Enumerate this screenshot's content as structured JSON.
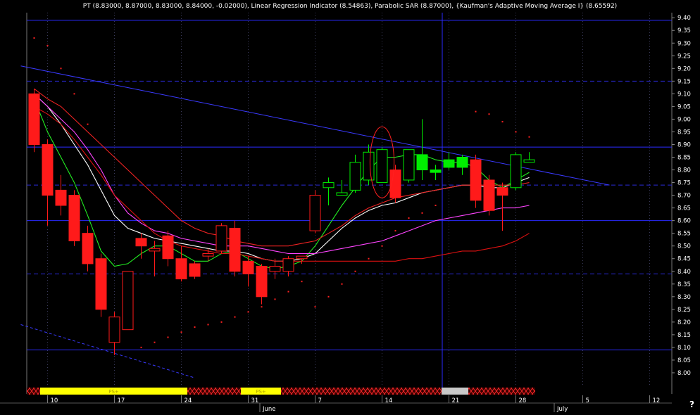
{
  "chart_data": {
    "type": "candlestick",
    "title": "PT (8.83000, 8.87000, 8.83000, 8.84000, -0.02000), Linear Regression Indicator (8.54863), Parabolic SAR (8.87000), {Kaufman's Adaptive Moving Average I} (8.65592)",
    "ylim": [
      7.95,
      9.42
    ],
    "y_ticks": [
      "9.40",
      "9.35",
      "9.30",
      "9.25",
      "9.20",
      "9.15",
      "9.10",
      "9.05",
      "9.00",
      "8.95",
      "8.90",
      "8.85",
      "8.80",
      "8.75",
      "8.70",
      "8.65",
      "8.60",
      "8.55",
      "8.50",
      "8.45",
      "8.40",
      "8.35",
      "8.30",
      "8.25",
      "8.20",
      "8.15",
      "8.10",
      "8.05",
      "8.00"
    ],
    "x_day_labels": [
      {
        "label": "10",
        "i": 1
      },
      {
        "label": "17",
        "i": 6
      },
      {
        "label": "24",
        "i": 11
      },
      {
        "label": "31",
        "i": 16
      },
      {
        "label": "7",
        "i": 21
      },
      {
        "label": "14",
        "i": 26
      },
      {
        "label": "21",
        "i": 31
      },
      {
        "label": "28",
        "i": 36
      },
      {
        "label": "5",
        "i": 41
      },
      {
        "label": "12",
        "i": 46
      }
    ],
    "x_month_labels": [
      {
        "label": "June",
        "i": 17.5
      },
      {
        "label": "July",
        "i": 39.5
      }
    ],
    "candles": [
      {
        "o": 9.1,
        "h": 9.12,
        "l": 8.87,
        "c": 8.9,
        "color": "red"
      },
      {
        "o": 8.9,
        "h": 8.92,
        "l": 8.58,
        "c": 8.7,
        "color": "red"
      },
      {
        "o": 8.72,
        "h": 8.78,
        "l": 8.62,
        "c": 8.66,
        "color": "red"
      },
      {
        "o": 8.7,
        "h": 8.72,
        "l": 8.5,
        "c": 8.52,
        "color": "red"
      },
      {
        "o": 8.55,
        "h": 8.58,
        "l": 8.4,
        "c": 8.43,
        "color": "red"
      },
      {
        "o": 8.45,
        "h": 8.47,
        "l": 8.22,
        "c": 8.25,
        "color": "red"
      },
      {
        "o": 8.12,
        "h": 8.24,
        "l": 8.07,
        "c": 8.22,
        "color": "red"
      },
      {
        "o": 8.17,
        "h": 8.4,
        "l": 8.17,
        "c": 8.4,
        "color": "red"
      },
      {
        "o": 8.53,
        "h": 8.55,
        "l": 8.45,
        "c": 8.5,
        "color": "red"
      },
      {
        "o": 8.48,
        "h": 8.52,
        "l": 8.38,
        "c": 8.49,
        "color": "red"
      },
      {
        "o": 8.54,
        "h": 8.56,
        "l": 8.42,
        "c": 8.45,
        "color": "red"
      },
      {
        "o": 8.45,
        "h": 8.5,
        "l": 8.36,
        "c": 8.37,
        "color": "red"
      },
      {
        "o": 8.43,
        "h": 8.44,
        "l": 8.37,
        "c": 8.38,
        "color": "red"
      },
      {
        "o": 8.46,
        "h": 8.49,
        "l": 8.44,
        "c": 8.47,
        "color": "red"
      },
      {
        "o": 8.48,
        "h": 8.59,
        "l": 8.47,
        "c": 8.58,
        "color": "red"
      },
      {
        "o": 8.57,
        "h": 8.6,
        "l": 8.38,
        "c": 8.4,
        "color": "red"
      },
      {
        "o": 8.44,
        "h": 8.46,
        "l": 8.34,
        "c": 8.39,
        "color": "red"
      },
      {
        "o": 8.42,
        "h": 8.43,
        "l": 8.27,
        "c": 8.3,
        "color": "red"
      },
      {
        "o": 8.4,
        "h": 8.45,
        "l": 8.37,
        "c": 8.42,
        "color": "red"
      },
      {
        "o": 8.4,
        "h": 8.46,
        "l": 8.38,
        "c": 8.45,
        "color": "red"
      },
      {
        "o": 8.45,
        "h": 8.46,
        "l": 8.43,
        "c": 8.46,
        "color": "red"
      },
      {
        "o": 8.56,
        "h": 8.72,
        "l": 8.55,
        "c": 8.7,
        "color": "red"
      },
      {
        "o": 8.73,
        "h": 8.77,
        "l": 8.66,
        "c": 8.75,
        "color": "green"
      },
      {
        "o": 8.7,
        "h": 8.76,
        "l": 8.7,
        "c": 8.71,
        "color": "green"
      },
      {
        "o": 8.72,
        "h": 8.86,
        "l": 8.71,
        "c": 8.83,
        "color": "green"
      },
      {
        "o": 8.76,
        "h": 8.9,
        "l": 8.74,
        "c": 8.87,
        "color": "green"
      },
      {
        "o": 8.75,
        "h": 8.89,
        "l": 8.75,
        "c": 8.88,
        "color": "green"
      },
      {
        "o": 8.8,
        "h": 8.82,
        "l": 8.67,
        "c": 8.69,
        "color": "red"
      },
      {
        "o": 8.76,
        "h": 8.88,
        "l": 8.75,
        "c": 8.88,
        "color": "green"
      },
      {
        "o": 8.86,
        "h": 9.0,
        "l": 8.76,
        "c": 8.8,
        "color": "green"
      },
      {
        "o": 8.8,
        "h": 8.82,
        "l": 8.76,
        "c": 8.79,
        "color": "green"
      },
      {
        "o": 8.84,
        "h": 8.87,
        "l": 8.8,
        "c": 8.81,
        "color": "green"
      },
      {
        "o": 8.85,
        "h": 8.86,
        "l": 8.78,
        "c": 8.81,
        "color": "green"
      },
      {
        "o": 8.84,
        "h": 8.86,
        "l": 8.65,
        "c": 8.68,
        "color": "red"
      },
      {
        "o": 8.76,
        "h": 8.78,
        "l": 8.62,
        "c": 8.64,
        "color": "red"
      },
      {
        "o": 8.73,
        "h": 8.75,
        "l": 8.56,
        "c": 8.7,
        "color": "red"
      },
      {
        "o": 8.73,
        "h": 8.87,
        "l": 8.72,
        "c": 8.86,
        "color": "green"
      },
      {
        "o": 8.83,
        "h": 8.87,
        "l": 8.83,
        "c": 8.84,
        "color": "green"
      }
    ],
    "series": [
      {
        "color": "#ffffff",
        "values": [
          9.1,
          9.05,
          8.98,
          8.9,
          8.82,
          8.72,
          8.62,
          8.57,
          8.55,
          8.53,
          8.52,
          8.51,
          8.5,
          8.49,
          8.48,
          8.48,
          8.47,
          8.45,
          8.44,
          8.44,
          8.45,
          8.47,
          8.52,
          8.57,
          8.61,
          8.64,
          8.66,
          8.67,
          8.69,
          8.71,
          8.72,
          8.73,
          8.74,
          8.74,
          8.73,
          8.73,
          8.75,
          8.77
        ]
      },
      {
        "color": "#22ee22",
        "values": [
          9.08,
          8.95,
          8.85,
          8.75,
          8.62,
          8.48,
          8.42,
          8.43,
          8.47,
          8.5,
          8.5,
          8.47,
          8.44,
          8.44,
          8.47,
          8.48,
          8.45,
          8.42,
          8.41,
          8.42,
          8.44,
          8.5,
          8.58,
          8.66,
          8.73,
          8.8,
          8.85,
          8.85,
          8.86,
          8.86,
          8.84,
          8.83,
          8.83,
          8.81,
          8.76,
          8.73,
          8.76,
          8.79
        ]
      },
      {
        "color": "#ff44ff",
        "values": [
          9.1,
          9.05,
          9.0,
          8.95,
          8.88,
          8.8,
          8.7,
          8.63,
          8.59,
          8.56,
          8.55,
          8.53,
          8.52,
          8.51,
          8.5,
          8.5,
          8.5,
          8.49,
          8.48,
          8.47,
          8.47,
          8.47,
          8.48,
          8.49,
          8.5,
          8.51,
          8.52,
          8.54,
          8.56,
          8.58,
          8.6,
          8.61,
          8.62,
          8.63,
          8.64,
          8.65,
          8.65,
          8.66
        ]
      },
      {
        "color": "#ee2222",
        "values": [
          9.12,
          9.08,
          9.05,
          9.0,
          8.95,
          8.9,
          8.85,
          8.8,
          8.75,
          8.7,
          8.65,
          8.6,
          8.57,
          8.55,
          8.54,
          8.52,
          8.51,
          8.5,
          8.5,
          8.5,
          8.51,
          8.52,
          8.55,
          8.58,
          8.62,
          8.65,
          8.67,
          8.69,
          8.7,
          8.71,
          8.72,
          8.73,
          8.74,
          8.74,
          8.74,
          8.74,
          8.74,
          8.75
        ]
      },
      {
        "color": "#dd1111",
        "values": [
          9.05,
          9.02,
          8.98,
          8.92,
          8.85,
          8.78,
          8.7,
          8.65,
          8.6,
          8.55,
          8.52,
          8.5,
          8.49,
          8.48,
          8.47,
          8.47,
          8.46,
          8.45,
          8.44,
          8.44,
          8.44,
          8.44,
          8.44,
          8.44,
          8.44,
          8.44,
          8.44,
          8.44,
          8.45,
          8.45,
          8.46,
          8.47,
          8.48,
          8.48,
          8.49,
          8.5,
          8.52,
          8.55
        ]
      }
    ],
    "sar_points": [
      [
        0,
        9.32
      ],
      [
        1,
        9.29
      ],
      [
        2,
        9.2
      ],
      [
        3,
        9.1
      ],
      [
        4,
        8.98
      ],
      [
        8,
        8.1
      ],
      [
        9,
        8.12
      ],
      [
        10,
        8.14
      ],
      [
        11,
        8.16
      ],
      [
        12,
        8.18
      ],
      [
        13,
        8.19
      ],
      [
        14,
        8.2
      ],
      [
        15,
        8.22
      ],
      [
        16,
        8.24
      ],
      [
        17,
        8.26
      ],
      [
        18,
        8.29
      ],
      [
        19,
        8.32
      ],
      [
        20,
        8.36
      ],
      [
        21,
        8.26
      ],
      [
        22,
        8.3
      ],
      [
        23,
        8.35
      ],
      [
        24,
        8.4
      ],
      [
        25,
        8.45
      ],
      [
        26,
        8.5
      ],
      [
        27,
        8.56
      ],
      [
        28,
        8.61
      ],
      [
        29,
        8.63
      ],
      [
        30,
        8.66
      ],
      [
        33,
        9.03
      ],
      [
        34,
        9.02
      ],
      [
        35,
        8.99
      ],
      [
        36,
        8.95
      ],
      [
        37,
        8.93
      ]
    ],
    "horizontal_lines": [
      9.39,
      8.89,
      8.6,
      8.09
    ],
    "dashed_levels": [
      9.15,
      8.74,
      8.39
    ],
    "vertical_line_i": 30.5,
    "trendlines": [
      {
        "i1": -1,
        "v1": 9.21,
        "i2": 43,
        "v2": 8.74,
        "dashed": false
      },
      {
        "i1": -1,
        "v1": 8.19,
        "i2": 12,
        "v2": 7.98,
        "dashed": true
      }
    ],
    "circle": {
      "i": 26,
      "v": 8.83,
      "rx_bars": 0.9,
      "ry_value": 0.14
    },
    "signal_bar": [
      {
        "from": 0,
        "to": 1,
        "style": "cross"
      },
      {
        "from": 1,
        "to": 12,
        "style": "yellow",
        "label": "PS+"
      },
      {
        "from": 12,
        "to": 16,
        "style": "cross"
      },
      {
        "from": 16,
        "to": 19,
        "style": "yellow",
        "label": "PS+"
      },
      {
        "from": 19,
        "to": 31,
        "style": "cross"
      },
      {
        "from": 31,
        "to": 33,
        "style": "gray"
      },
      {
        "from": 33,
        "to": 38,
        "style": "cross"
      }
    ],
    "corner_mark": "?"
  }
}
